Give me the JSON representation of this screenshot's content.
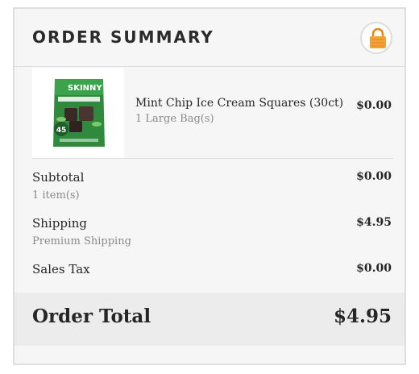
{
  "summary": {
    "title": "ORDER SUMMARY",
    "lock_icon": "lock-icon",
    "lock_color": "#f2a23a"
  },
  "items": [
    {
      "name": "Mint Chip Ice Cream Squares (30ct)",
      "variant": "1 Large Bag(s)",
      "price": "$0.00",
      "image_label": "SKINNY",
      "image_count": "45"
    }
  ],
  "rows": {
    "subtotal": {
      "label": "Subtotal",
      "sub": "1 item(s)",
      "value": "$0.00"
    },
    "shipping": {
      "label": "Shipping",
      "sub": "Premium Shipping",
      "value": "$4.95"
    },
    "tax": {
      "label": "Sales Tax",
      "value": "$0.00"
    }
  },
  "total": {
    "label": "Order Total",
    "value": "$4.95"
  },
  "colors": {
    "panel_bg": "#f6f6f6",
    "border": "#dedede",
    "total_bg": "#ececec",
    "product_green": "#2f8a3e"
  }
}
